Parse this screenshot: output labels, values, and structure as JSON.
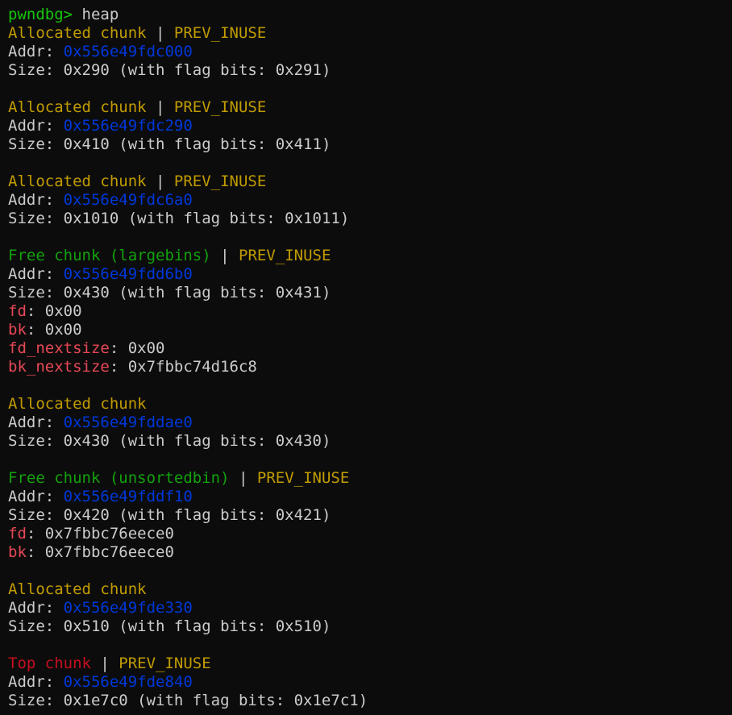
{
  "colors": {
    "background": "#0c0c0c",
    "text": "#cccccc",
    "prompt": "#16c60c",
    "yellow": "#c19c00",
    "green": "#13a10e",
    "red": "#c50f1f",
    "blue": "#0037da",
    "field": "#e74856"
  },
  "prompt": {
    "text": "pwndbg>",
    "command": "heap"
  },
  "chunks": [
    {
      "status": "Allocated chunk",
      "status_color": "yellow",
      "separator": " | ",
      "flag": "PREV_INUSE",
      "addr_label": "Addr: ",
      "addr": "0x556e49fdc000",
      "size_label": "Size: ",
      "size": "0x290",
      "flag_bits_text": " (with flag bits: 0x291)",
      "fields": []
    },
    {
      "status": "Allocated chunk",
      "status_color": "yellow",
      "separator": " | ",
      "flag": "PREV_INUSE",
      "addr_label": "Addr: ",
      "addr": "0x556e49fdc290",
      "size_label": "Size: ",
      "size": "0x410",
      "flag_bits_text": " (with flag bits: 0x411)",
      "fields": []
    },
    {
      "status": "Allocated chunk",
      "status_color": "yellow",
      "separator": " | ",
      "flag": "PREV_INUSE",
      "addr_label": "Addr: ",
      "addr": "0x556e49fdc6a0",
      "size_label": "Size: ",
      "size": "0x1010",
      "flag_bits_text": " (with flag bits: 0x1011)",
      "fields": []
    },
    {
      "status": "Free chunk (largebins)",
      "status_color": "green",
      "separator": " | ",
      "flag": "PREV_INUSE",
      "addr_label": "Addr: ",
      "addr": "0x556e49fdd6b0",
      "size_label": "Size: ",
      "size": "0x430",
      "flag_bits_text": " (with flag bits: 0x431)",
      "fields": [
        {
          "name": "fd",
          "value": ": 0x00"
        },
        {
          "name": "bk",
          "value": ": 0x00"
        },
        {
          "name": "fd_nextsize",
          "value": ": 0x00"
        },
        {
          "name": "bk_nextsize",
          "value": ": 0x7fbbc74d16c8"
        }
      ]
    },
    {
      "status": "Allocated chunk",
      "status_color": "yellow",
      "separator": "",
      "flag": "",
      "addr_label": "Addr: ",
      "addr": "0x556e49fddae0",
      "size_label": "Size: ",
      "size": "0x430",
      "flag_bits_text": " (with flag bits: 0x430)",
      "fields": []
    },
    {
      "status": "Free chunk (unsortedbin)",
      "status_color": "green",
      "separator": " | ",
      "flag": "PREV_INUSE",
      "addr_label": "Addr: ",
      "addr": "0x556e49fddf10",
      "size_label": "Size: ",
      "size": "0x420",
      "flag_bits_text": " (with flag bits: 0x421)",
      "fields": [
        {
          "name": "fd",
          "value": ": 0x7fbbc76eece0"
        },
        {
          "name": "bk",
          "value": ": 0x7fbbc76eece0"
        }
      ]
    },
    {
      "status": "Allocated chunk",
      "status_color": "yellow",
      "separator": "",
      "flag": "",
      "addr_label": "Addr: ",
      "addr": "0x556e49fde330",
      "size_label": "Size: ",
      "size": "0x510",
      "flag_bits_text": " (with flag bits: 0x510)",
      "fields": []
    },
    {
      "status": "Top chunk",
      "status_color": "red",
      "separator": " | ",
      "flag": "PREV_INUSE",
      "addr_label": "Addr: ",
      "addr": "0x556e49fde840",
      "size_label": "Size: ",
      "size": "0x1e7c0",
      "flag_bits_text": " (with flag bits: 0x1e7c1)",
      "fields": []
    }
  ]
}
